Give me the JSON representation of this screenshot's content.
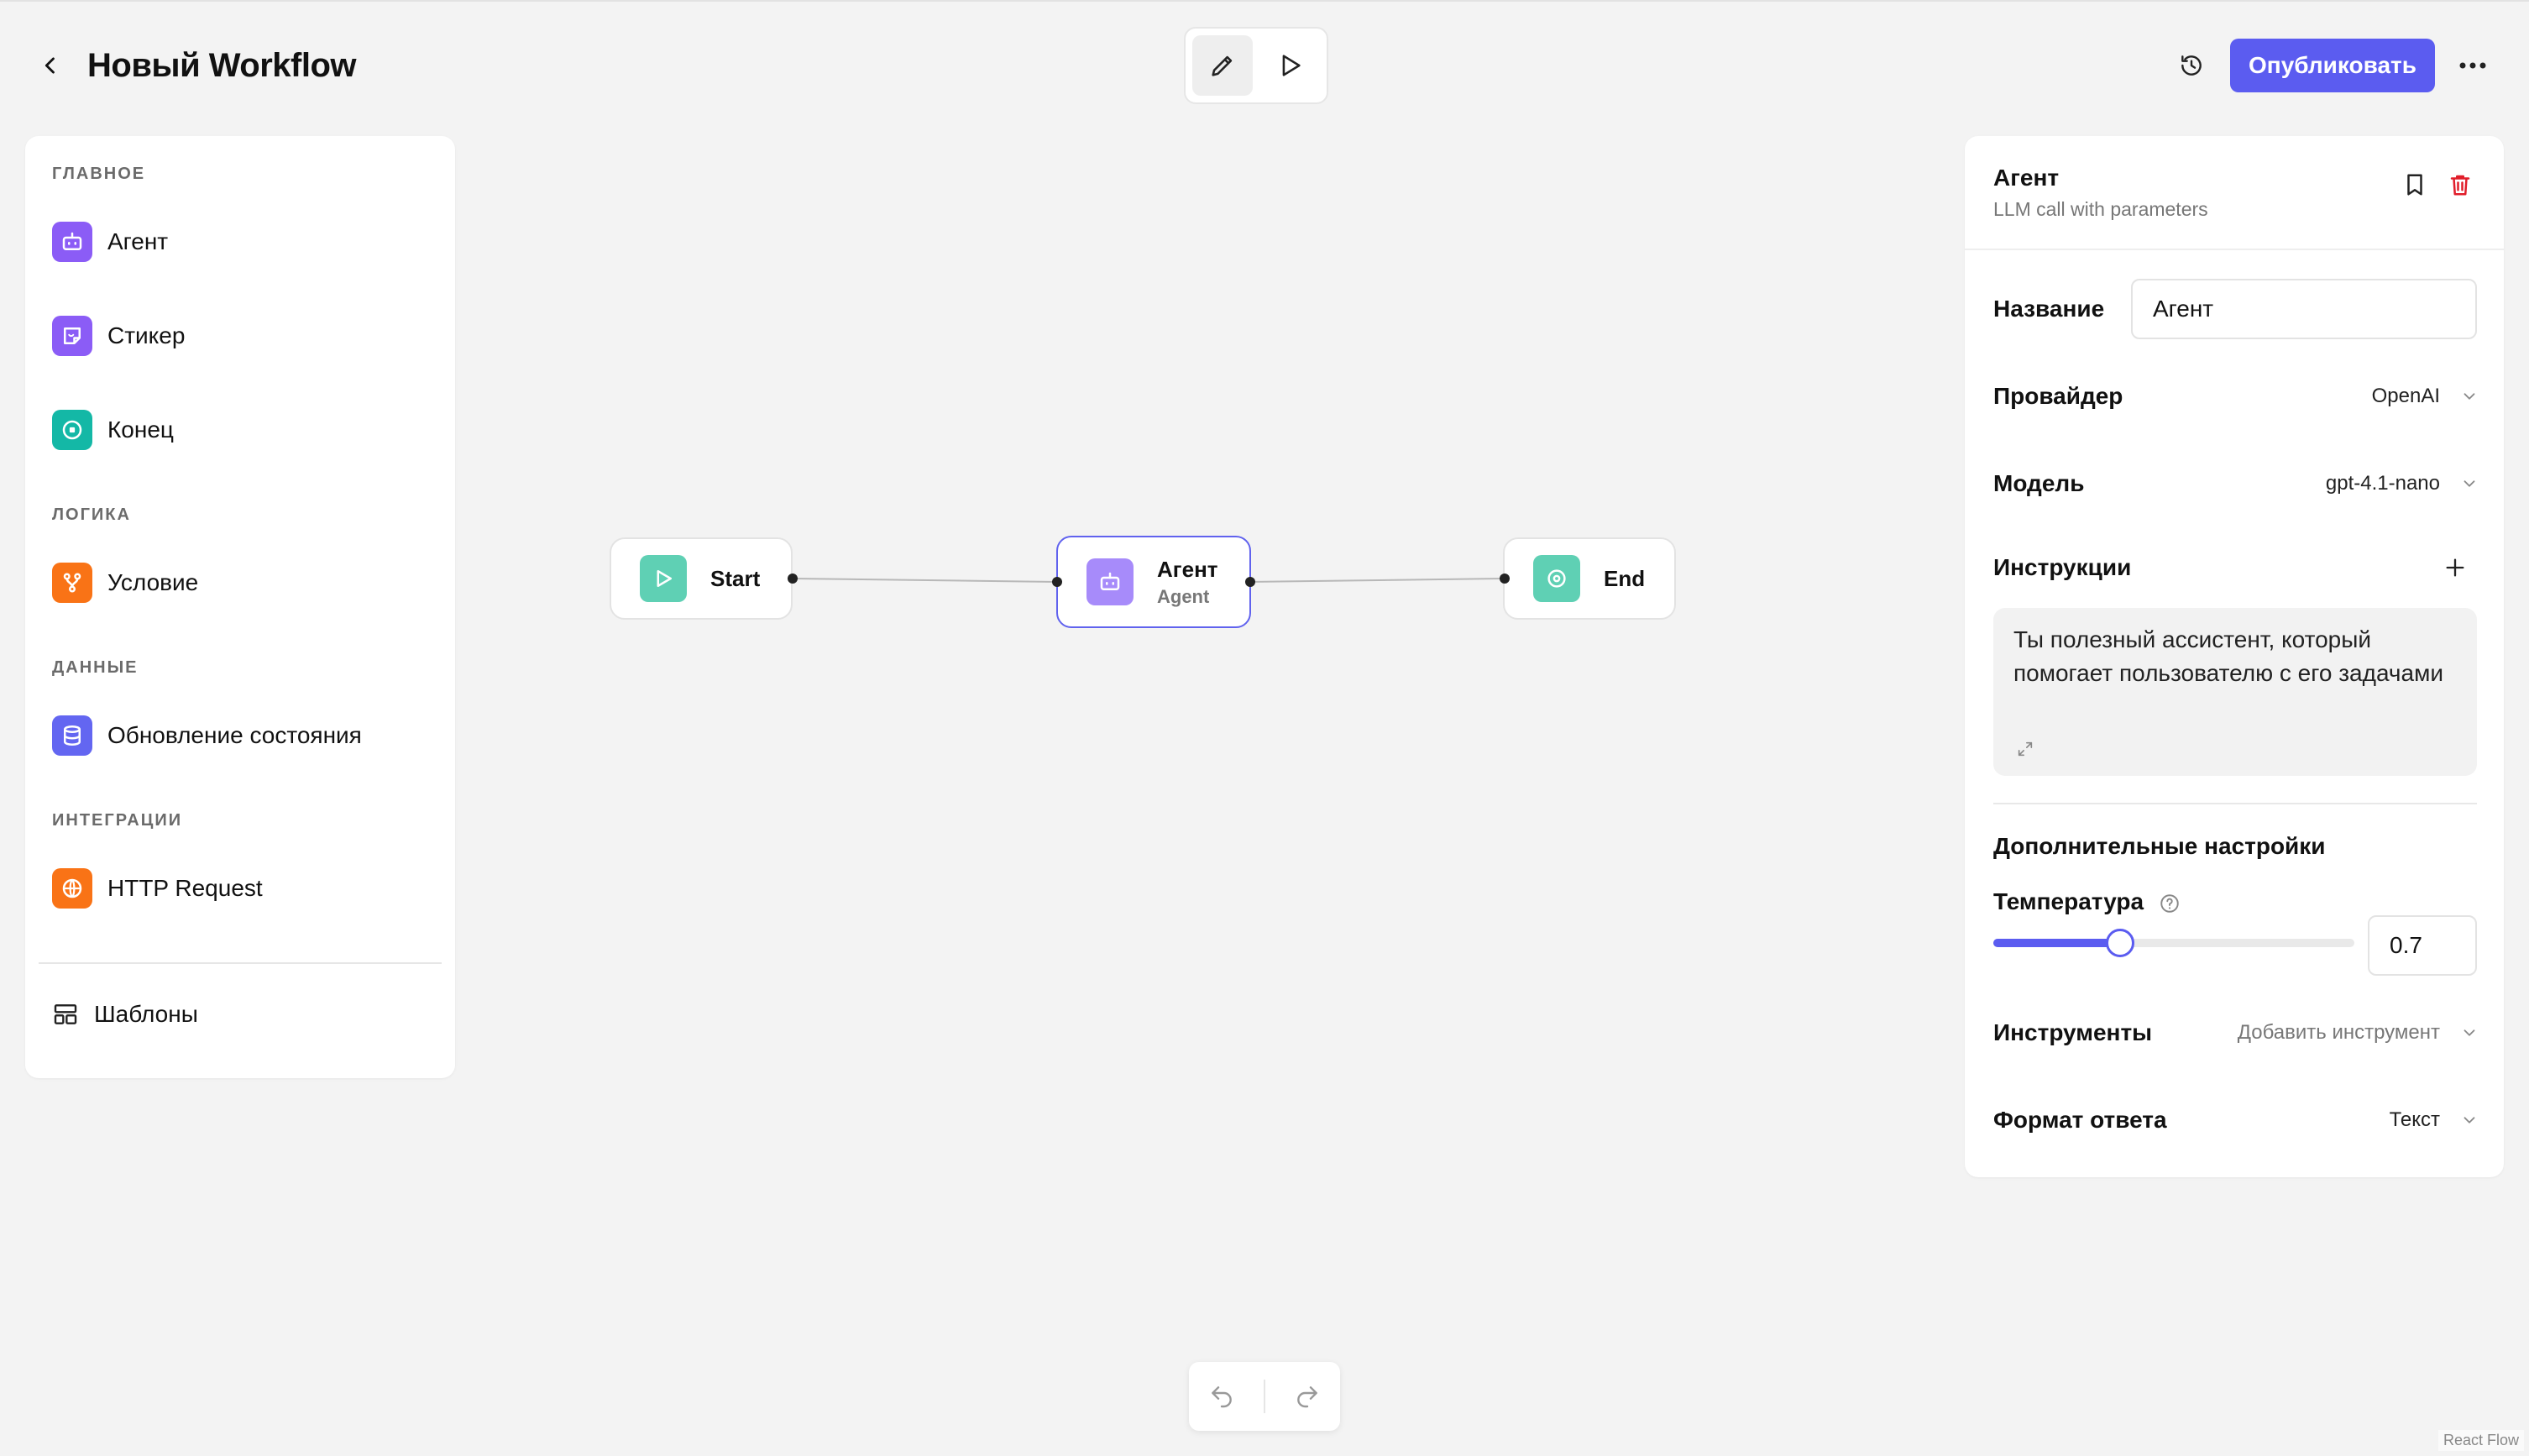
{
  "header": {
    "title": "Новый Workflow",
    "publish_label": "Опубликовать"
  },
  "sidebar": {
    "sections": [
      {
        "label": "ГЛАВНОЕ",
        "items": [
          {
            "label": "Агент",
            "icon": "bot-icon",
            "color": "#8b5cf6"
          },
          {
            "label": "Стикер",
            "icon": "sticker-icon",
            "color": "#8b5cf6"
          },
          {
            "label": "Конец",
            "icon": "stop-circle-icon",
            "color": "#14b8a6"
          }
        ]
      },
      {
        "label": "ЛОГИКА",
        "items": [
          {
            "label": "Условие",
            "icon": "branch-icon",
            "color": "#f97316"
          }
        ]
      },
      {
        "label": "ДАННЫЕ",
        "items": [
          {
            "label": "Обновление состояния",
            "icon": "database-icon",
            "color": "#6366f1"
          }
        ]
      },
      {
        "label": "ИНТЕГРАЦИИ",
        "items": [
          {
            "label": "HTTP Request",
            "icon": "globe-icon",
            "color": "#f97316"
          }
        ]
      }
    ],
    "templates_label": "Шаблоны"
  },
  "canvas": {
    "nodes": [
      {
        "id": "start",
        "title": "Start",
        "subtitle": "",
        "icon": "play-icon",
        "color": "#5fd0b4"
      },
      {
        "id": "agent",
        "title": "Агент",
        "subtitle": "Agent",
        "icon": "bot-icon",
        "color": "#a78bfa",
        "selected": true
      },
      {
        "id": "end",
        "title": "End",
        "subtitle": "",
        "icon": "stop-circle-icon",
        "color": "#5fd0b4"
      }
    ],
    "attribution": "React Flow"
  },
  "inspector": {
    "title": "Агент",
    "subtitle": "LLM call with parameters",
    "name_label": "Название",
    "name_value": "Агент",
    "provider_label": "Провайдер",
    "provider_value": "OpenAI",
    "model_label": "Модель",
    "model_value": "gpt-4.1-nano",
    "instructions_label": "Инструкции",
    "instructions_value": "Ты полезный ассистент, который помогает пользователю с его задачами",
    "advanced_title": "Дополнительные настройки",
    "temperature_label": "Температура",
    "temperature_value": "0.7",
    "temperature_fraction": 0.35,
    "tools_label": "Инструменты",
    "tools_placeholder": "Добавить инструмент",
    "format_label": "Формат ответа",
    "format_value": "Текст"
  },
  "colors": {
    "accent": "#5b5cf0",
    "danger": "#e11d2a"
  }
}
